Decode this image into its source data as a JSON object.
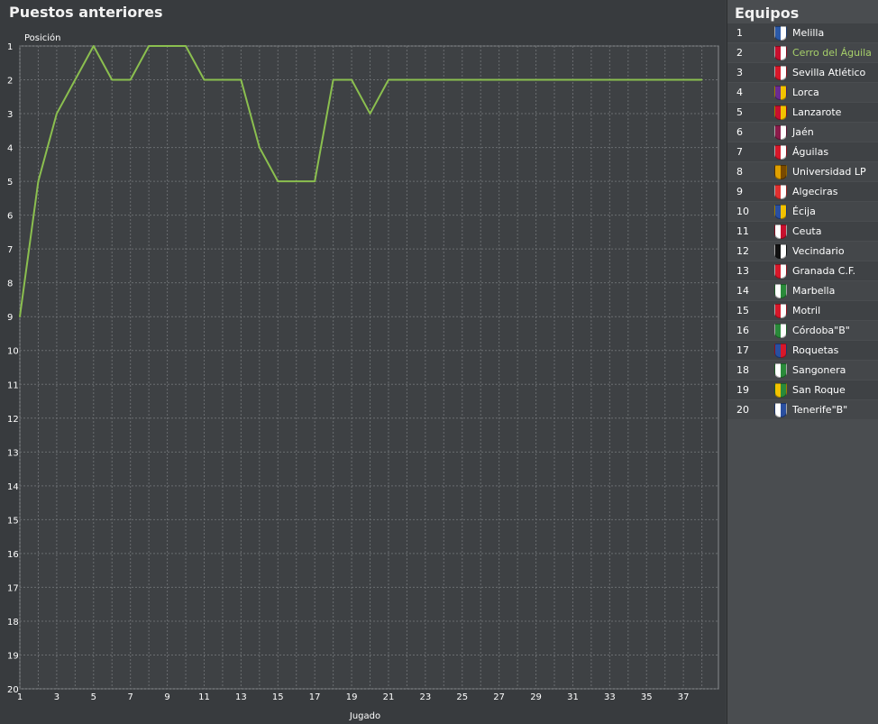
{
  "left_panel": {
    "title": "Puestos anteriores"
  },
  "right_panel": {
    "title": "Equipos",
    "selected_index": 1,
    "teams": [
      {
        "pos": "1",
        "name": "Melilla",
        "crest": "crest-melilla-icon",
        "colors": [
          "#2c5aa8",
          "#ffffff"
        ]
      },
      {
        "pos": "2",
        "name": "Cerro del Águila",
        "crest": "crest-cerro-icon",
        "colors": [
          "#c8102e",
          "#ffffff"
        ]
      },
      {
        "pos": "3",
        "name": "Sevilla Atlético",
        "crest": "crest-sevilla-icon",
        "colors": [
          "#d7182a",
          "#ffffff"
        ]
      },
      {
        "pos": "4",
        "name": "Lorca",
        "crest": "crest-lorca-icon",
        "colors": [
          "#6a2c91",
          "#f2c200"
        ]
      },
      {
        "pos": "5",
        "name": "Lanzarote",
        "crest": "crest-lanzarote-icon",
        "colors": [
          "#c8102e",
          "#f2c200"
        ]
      },
      {
        "pos": "6",
        "name": "Jaén",
        "crest": "crest-jaen-icon",
        "colors": [
          "#8a1c4a",
          "#ffffff"
        ]
      },
      {
        "pos": "7",
        "name": "Águilas",
        "crest": "crest-aguilas-icon",
        "colors": [
          "#d7182a",
          "#ffffff"
        ]
      },
      {
        "pos": "8",
        "name": "Universidad LP",
        "crest": "crest-ulp-icon",
        "colors": [
          "#e0a000",
          "#7a4a00"
        ]
      },
      {
        "pos": "9",
        "name": "Algeciras",
        "crest": "crest-algeciras-icon",
        "colors": [
          "#e03030",
          "#ffffff"
        ]
      },
      {
        "pos": "10",
        "name": "Écija",
        "crest": "crest-ecija-icon",
        "colors": [
          "#2a4fa0",
          "#f2c200"
        ]
      },
      {
        "pos": "11",
        "name": "Ceuta",
        "crest": "crest-ceuta-icon",
        "colors": [
          "#ffffff",
          "#c8102e"
        ]
      },
      {
        "pos": "12",
        "name": "Vecindario",
        "crest": "crest-vecindario-icon",
        "colors": [
          "#111111",
          "#ffffff"
        ]
      },
      {
        "pos": "13",
        "name": "Granada C.F.",
        "crest": "crest-granada-icon",
        "colors": [
          "#d7182a",
          "#ffffff"
        ]
      },
      {
        "pos": "14",
        "name": "Marbella",
        "crest": "crest-marbella-icon",
        "colors": [
          "#ffffff",
          "#2a8a3a"
        ]
      },
      {
        "pos": "15",
        "name": "Motril",
        "crest": "crest-motril-icon",
        "colors": [
          "#d7182a",
          "#ffffff"
        ]
      },
      {
        "pos": "16",
        "name": "Córdoba\"B\"",
        "crest": "crest-cordoba-icon",
        "colors": [
          "#2a8a3a",
          "#ffffff"
        ]
      },
      {
        "pos": "17",
        "name": "Roquetas",
        "crest": "crest-roquetas-icon",
        "colors": [
          "#2a4fa0",
          "#d7182a"
        ]
      },
      {
        "pos": "18",
        "name": "Sangonera",
        "crest": "crest-sangonera-icon",
        "colors": [
          "#ffffff",
          "#2a8a3a"
        ]
      },
      {
        "pos": "19",
        "name": "San Roque",
        "crest": "crest-sanroque-icon",
        "colors": [
          "#f2c200",
          "#2a8a3a"
        ]
      },
      {
        "pos": "20",
        "name": "Tenerife\"B\"",
        "crest": "crest-tenerife-icon",
        "colors": [
          "#ffffff",
          "#2a4fa0"
        ]
      }
    ]
  },
  "chart_data": {
    "type": "line",
    "ylabel": "Posición",
    "xlabel": "Jugado",
    "ylim": [
      1,
      20
    ],
    "y_inverted": true,
    "xlim": [
      1,
      38
    ],
    "grid": true,
    "line_color": "#8bbf4f",
    "x_ticks": [
      1,
      3,
      5,
      7,
      9,
      11,
      13,
      15,
      17,
      19,
      21,
      23,
      25,
      27,
      29,
      31,
      33,
      35,
      37
    ],
    "y_ticks": [
      1,
      2,
      3,
      4,
      5,
      6,
      7,
      8,
      9,
      10,
      11,
      12,
      13,
      14,
      15,
      16,
      17,
      18,
      19,
      20
    ],
    "series": [
      {
        "x": [
          1,
          2,
          3,
          4,
          5,
          6,
          7,
          8,
          9,
          10,
          11,
          12,
          13,
          14,
          15,
          16,
          17,
          18,
          19,
          20,
          21,
          22,
          23,
          24,
          25,
          26,
          27,
          28,
          29,
          30,
          31,
          32,
          33,
          34,
          35,
          36,
          37,
          38
        ],
        "values": [
          9,
          5,
          3,
          2,
          1,
          2,
          2,
          1,
          1,
          1,
          2,
          2,
          2,
          4,
          5,
          5,
          5,
          2,
          2,
          3,
          2,
          2,
          2,
          2,
          2,
          2,
          2,
          2,
          2,
          2,
          2,
          2,
          2,
          2,
          2,
          2,
          2,
          2
        ]
      }
    ]
  }
}
